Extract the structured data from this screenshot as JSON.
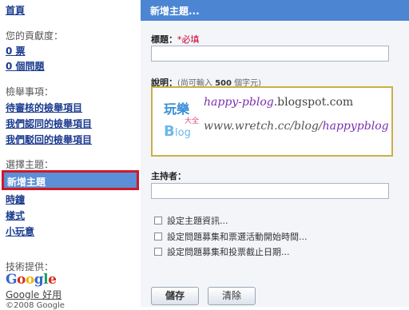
{
  "sidebar": {
    "home_link": "首頁",
    "contrib_label": "您的貢獻度：",
    "votes_link": "0 票",
    "questions_link": "0 個問題",
    "report_label": "檢舉事項：",
    "report_pending": "待審核的檢舉項目",
    "report_confirmed": "我們認同的檢舉項目",
    "report_rejected": "我們駁回的檢舉項目",
    "choose_label": "選擇主題：",
    "new_topic_selected": "新增主題",
    "topic_flash": "時鐘",
    "topic_style": "樣式",
    "topic_game": "小玩意",
    "tech_label": "技術提供：",
    "google_logo": "Google",
    "google_friends": "Google 好用",
    "copyright_partial": "©2008 Google"
  },
  "main": {
    "title": "新增主題...",
    "title_label": "標題：",
    "title_required": "*必填",
    "desc_label": "說明：",
    "desc_hint_pre": "(尚可輸入 ",
    "desc_hint_num": "500",
    "desc_hint_post": " 個字元)",
    "blog_logo_text_top": "玩樂",
    "blog_logo_text_small": "大全",
    "blog_logo_text_bottom": "Blog",
    "blog_line1_italic": "happy-pblog",
    "blog_line1_plain": ".blogspot.com",
    "blog_line2_plain": "www.wretch.cc/blog/",
    "blog_line2_italic": "happypblog",
    "host_label": "主持者：",
    "checkbox_1": "設定主題資訊...",
    "checkbox_2": "設定問題募集和票選活動開始時間...",
    "checkbox_3": "設定問題募集和投票截止日期...",
    "save_button": "儲存",
    "clear_button": "清除"
  },
  "colors": {
    "titlebar": "#4c86d3",
    "selection_highlight": "#5b8fd6",
    "selection_border": "#d0182a",
    "link": "#1a3a8f"
  }
}
